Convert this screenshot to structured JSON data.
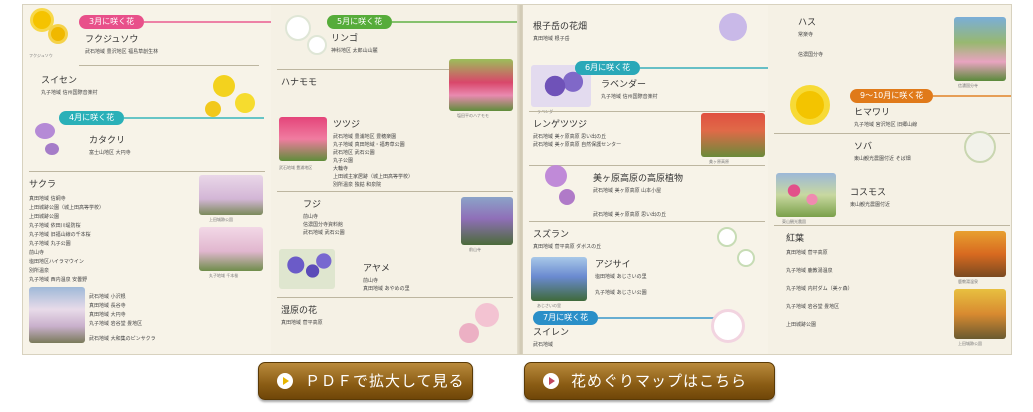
{
  "brochure": {
    "sections": [
      {
        "id": "march",
        "label": "3月に咲く花",
        "color": "#e8508a"
      },
      {
        "id": "april",
        "label": "4月に咲く花",
        "color": "#2ab0b8"
      },
      {
        "id": "may",
        "label": "5月に咲く花",
        "color": "#56ac3a"
      },
      {
        "id": "june",
        "label": "6月に咲く花",
        "color": "#2aa8b8"
      },
      {
        "id": "july",
        "label": "7月に咲く花",
        "color": "#2a8fc8"
      },
      {
        "id": "sepoct",
        "label": "9〜10月に咲く花",
        "color": "#e07a1a"
      }
    ],
    "flowers": {
      "fukujuso": "フクジュソウ",
      "suisen": "スイセン",
      "katakuri": "カタクリ",
      "sakura": "サクラ",
      "ringo": "リンゴ",
      "hanamomo": "ハナモモ",
      "tsutsuji": "ツツジ",
      "fuji": "フジ",
      "ayame": "アヤメ",
      "shitsugen": "湿原の花",
      "nekonohanabatake": "根子岳の花畑",
      "lavender": "ラベンダー",
      "lengetsutsuji": "レンゲツツジ",
      "kogen": "美ヶ原高原の高原植物",
      "suzuran": "スズラン",
      "ajisai": "アジサイ",
      "suiren": "スイレン",
      "hasu": "ハス",
      "himawari": "ヒマワリ",
      "soba": "ソバ",
      "kosmos": "コスモス",
      "koyo": "紅葉"
    },
    "places": {
      "fukujuso_place": "武石地域 豊沢地区 福島草創生林",
      "suisen_place": "丸子地域 信州国際音楽村",
      "katakuri_place": "富士山地区 大円寺",
      "sakura_1": "真田地域 信綱寺",
      "sakura_2": "上田城跡公園（城上田高等学校）",
      "sakura_3": "上田城跡公園",
      "sakura_4": "丸子地域 依田川堤防桜",
      "sakura_5": "丸子地域 旧福山線の千本桜",
      "sakura_6": "丸子地域 丸子公園",
      "sakura_7": "前山寺",
      "sakura_8": "塩田地区ハイラマウイン",
      "sakura_9": "別所温泉",
      "sakura_10": "丸子地域 西内温泉 安曇野",
      "sakura_11": "武石地域 小沢根",
      "sakura_12": "真田地域 長谷寺",
      "sakura_13": "真田地域 大円寺",
      "sakura_14": "丸子地域 岩谷堂 畳地区",
      "sakura_15": "武石地域 大和集のピンサクラ",
      "ringo_place": "神科地区 太郎山山麓",
      "tsutsuji_1": "武石地域 豊浦地区 豊穂楽園",
      "tsutsuji_2": "丸子地域 真田地域・福寿草公園",
      "tsutsuji_3": "武石地区 武石公園",
      "tsutsuji_4": "丸子公園",
      "tsutsuji_5": "大輪寺",
      "tsutsuji_6": "上田城主家居跡（城上田高等学校）",
      "tsutsuji_7": "別所温泉 独鈷 和泉院",
      "fuji_1": "前山寺",
      "fuji_2": "信濃国分寺資料館",
      "fuji_3": "武石地域 武石公園",
      "ayame_place": "前山寺",
      "ayame_place2": "真田地域 あやめの里",
      "shitsugen_place": "真田地域 菅平高原",
      "neko_place": "真田地域 根子岳",
      "lavender_place": "丸子地域 信州国際音楽村",
      "lenge_1": "武石地域 美ヶ原高原 思い出の丘",
      "lenge_2": "武石地域 美ヶ原高原 自然保護センター",
      "kogen_1": "武石地域 美ヶ原高原 山本小屋",
      "kogen_2": "武石地域 美ヶ原高原 思い出の丘",
      "suzuran_place": "真田地域 菅平高原 ダボスの丘",
      "ajisai_1": "塩田地域 あじさいの里",
      "ajisai_2": "丸子地域 あじさい公園",
      "suiren_place": "武石地域",
      "hasu_1": "常楽寺",
      "hasu_2": "信濃国分寺",
      "himawari_place": "丸子地域 宮沢地区 旧郷山線",
      "soba_place": "東山観光農園付近 そば畑",
      "kosmos_place": "東山観光農園付近",
      "koyo_1": "真田地域 菅平高原",
      "koyo_2": "丸子地域 鹿教湯温泉",
      "koyo_3": "丸子地域 内村ダム（美ヶ森）",
      "koyo_4": "丸子地域 岩谷堂 畳地区",
      "koyo_5": "上田城跡公園"
    },
    "captions": {
      "fuku_cap": "フクジュソウ",
      "sakura_photo1": "上田城跡公園",
      "sakura_photo2": "丸子地域 千本桜",
      "hanamomo_photo": "塩田平のハナモモ",
      "tsutsuji_photo": "武石地域 豊浦地区",
      "fuji_photo": "前山寺",
      "lavender_photo": "ラベンダー",
      "lenge_photo": "美ヶ原高原",
      "ajisai_photo": "あじさいの里",
      "hasu_photo": "信濃国分寺",
      "kosmos_photo": "東山観光農園",
      "koyo_photo": "鹿教湯温泉",
      "koyo_photo2": "上田城跡公園"
    }
  },
  "buttons": {
    "pdf": "ＰＤＦで拡大して見る",
    "map": "花めぐりマップはこちら"
  },
  "colors": {
    "button_top": "#b98a3c",
    "button_bottom": "#6f4608"
  }
}
